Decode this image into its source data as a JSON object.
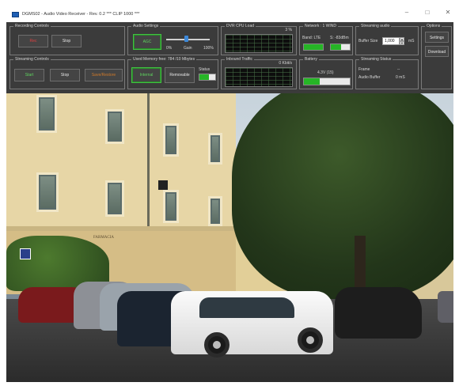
{
  "window": {
    "title": "DGMS02 - Audio Video Receiver - Rev. 0.2 *** CLIP 1000 ***",
    "controls": {
      "minimize": "–",
      "maximize": "□",
      "close": "✕"
    }
  },
  "recording_controls": {
    "legend": "Recording Controls",
    "rec_label": "Rec",
    "stop_label": "Stop"
  },
  "audio_settings": {
    "legend": "Audio Settings",
    "agc_label": "AGC",
    "gain_label": "Gain",
    "gain_min": "0%",
    "gain_max": "100%",
    "gain_fraction": 0.45
  },
  "cpu_load": {
    "legend": "DVR CPU Load",
    "value": "3 %"
  },
  "network": {
    "legend": "Network : 1 WIND",
    "band_label": "Band: LTE",
    "signal_label": "S: -83dBm",
    "band_fill": 1.0,
    "signal_fill": 0.55
  },
  "streaming_audio": {
    "legend": "Streaming audio",
    "buffer_label": "Buffer Size",
    "buffer_value": "1,000",
    "buffer_unit": "mS"
  },
  "options": {
    "legend": "Options",
    "settings_label": "Settings",
    "download_label": "Download"
  },
  "streaming_controls": {
    "legend": "Streaming Controls",
    "start_label": "Start",
    "stop_label": "Stop",
    "save_label": "Save/Restore"
  },
  "memory": {
    "legend": "Used Memory free: 784 /10 Mbytes",
    "internal_label": "Internal",
    "removable_label": "Removable",
    "status_label": "Status",
    "status_fill": 0.6
  },
  "inbound_traffic": {
    "legend": "Inbound Traffic",
    "value": "0 Kbit/s"
  },
  "battery": {
    "legend": "Battery",
    "voltage": "4.3V (15)",
    "fill": 0.35
  },
  "streaming_status": {
    "legend": "Streaming Status",
    "frame_label": "Frame",
    "frame_value": "--",
    "audio_buffer_label": "Audio Buffer",
    "audio_buffer_value": "0 mS"
  },
  "video": {
    "shop_sign": "FARMACIA"
  },
  "colors": {
    "accent_green": "#26b526",
    "rec_red": "#e04040",
    "panel_bg": "#3b3b3b"
  }
}
